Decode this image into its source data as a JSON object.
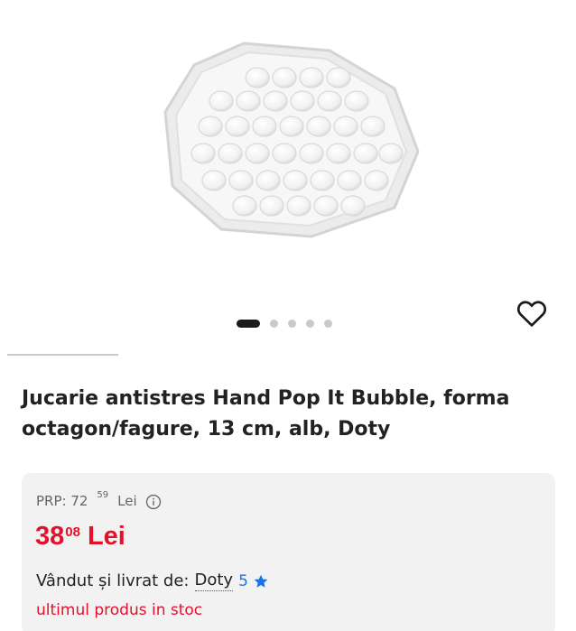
{
  "gallery": {
    "image_alt": "Jucarie antistres Hand Pop It Bubble, octagon, alb",
    "dots": 5,
    "active_index": 0
  },
  "product": {
    "title": "Jucarie antistres Hand Pop It Bubble, forma octagon/fagure, 13 cm, alb, Doty"
  },
  "pricing": {
    "prp_label": "PRP: 72",
    "prp_decimals": "59",
    "prp_currency": "Lei",
    "price_int": "38",
    "price_dec": "08",
    "price_currency": "Lei",
    "price_color": "#e5102a"
  },
  "seller": {
    "label": "Vândut și livrat de:",
    "name": "Doty",
    "rating": "5",
    "rating_color": "#1a73e8"
  },
  "stock": {
    "text": "ultimul produs in stoc"
  },
  "icons": {
    "favorite": "heart-outline-icon",
    "info": "info-circle-icon",
    "rating": "star-icon"
  }
}
